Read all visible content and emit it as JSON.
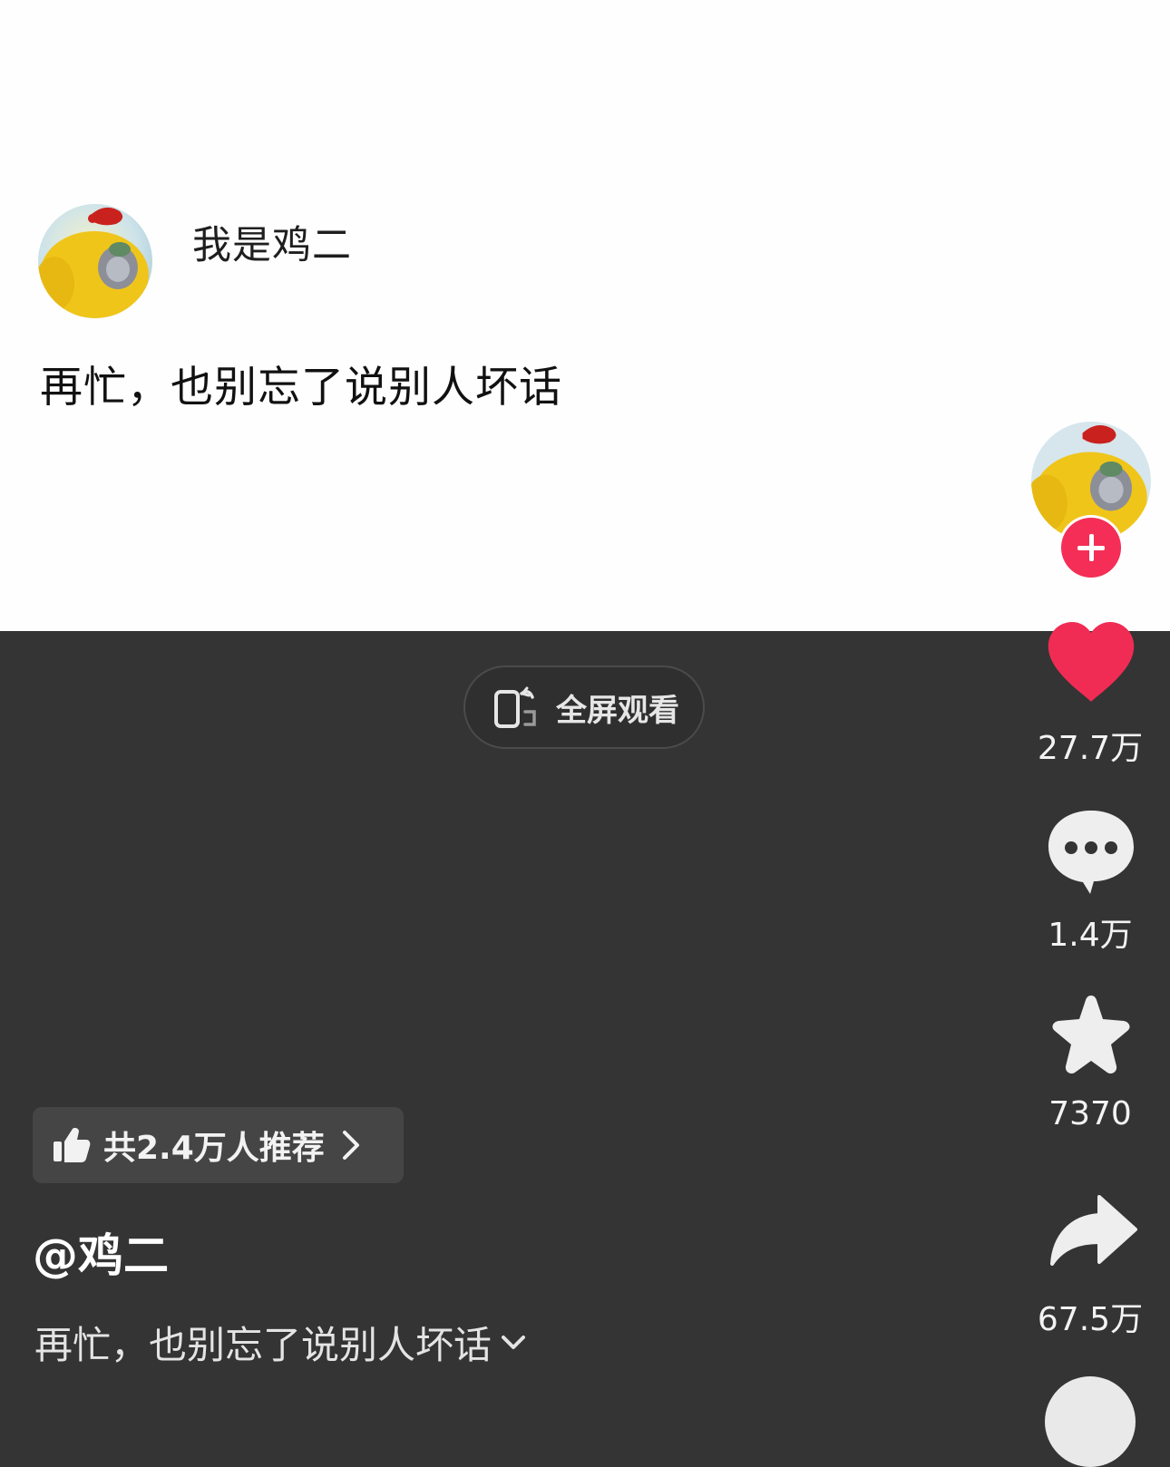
{
  "post": {
    "author_name": "我是鸡二",
    "text": "再忙，也别忘了说别人坏话"
  },
  "player": {
    "fullscreen_label": "全屏观看"
  },
  "sidebar": {
    "avatar_icon": "author-avatar",
    "follow_icon": "plus-icon",
    "like_count": "27.7万",
    "like_color": "#f02c54",
    "comment_count": "1.4万",
    "favorite_count": "7370",
    "share_count": "67.5万"
  },
  "recommend": {
    "label": "共2.4万人推荐"
  },
  "video": {
    "author": "@鸡二",
    "caption": "再忙，也别忘了说别人坏话"
  }
}
